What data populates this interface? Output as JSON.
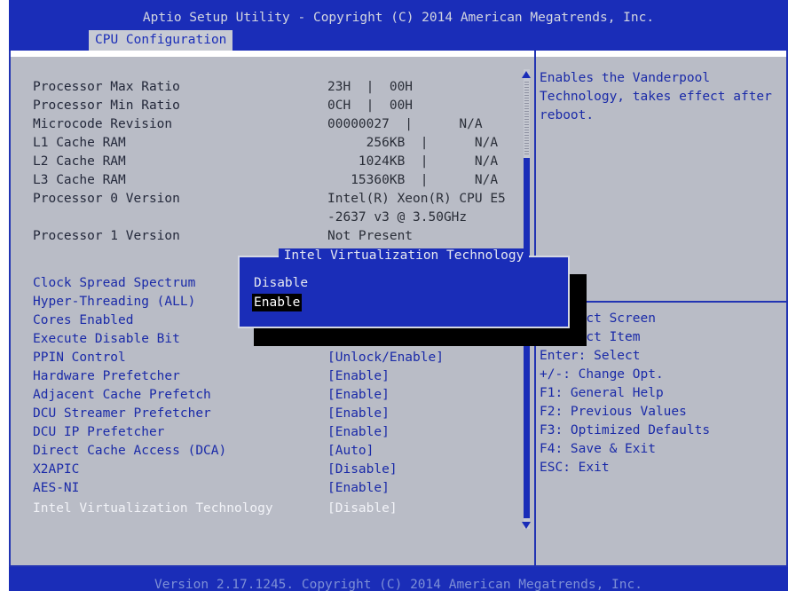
{
  "header": {
    "title": "Aptio Setup Utility - Copyright (C) 2014 American Megatrends, Inc.",
    "tab": "CPU Configuration"
  },
  "info_rows": [
    {
      "label": "Processor Max Ratio",
      "value": "23H  |  00H"
    },
    {
      "label": "Processor Min Ratio",
      "value": "0CH  |  00H"
    },
    {
      "label": "Microcode Revision",
      "value": "00000027  |      N/A"
    },
    {
      "label": "L1 Cache RAM",
      "value": "     256KB  |      N/A"
    },
    {
      "label": "L2 Cache RAM",
      "value": "    1024KB  |      N/A"
    },
    {
      "label": "L3 Cache RAM",
      "value": "   15360KB  |      N/A"
    },
    {
      "label": "Processor 0 Version",
      "value": "Intel(R) Xeon(R) CPU E5"
    },
    {
      "label": "",
      "value": "-2637 v3 @ 3.50GHz"
    },
    {
      "label": "Processor 1 Version",
      "value": "Not Present"
    }
  ],
  "settings": [
    {
      "label": "Clock Spread Spectrum",
      "value": ""
    },
    {
      "label": "Hyper-Threading (ALL)",
      "value": ""
    },
    {
      "label": "Cores Enabled",
      "value": ""
    },
    {
      "label": "Execute Disable Bit",
      "value": ""
    },
    {
      "label": "PPIN Control",
      "value": "[Unlock/Enable]"
    },
    {
      "label": "Hardware Prefetcher",
      "value": "[Enable]"
    },
    {
      "label": "Adjacent Cache Prefetch",
      "value": "[Enable]"
    },
    {
      "label": "DCU Streamer Prefetcher",
      "value": "[Enable]"
    },
    {
      "label": "DCU IP Prefetcher",
      "value": "[Enable]"
    },
    {
      "label": "Direct Cache Access (DCA)",
      "value": "[Auto]"
    },
    {
      "label": "X2APIC",
      "value": "[Disable]"
    },
    {
      "label": "AES-NI",
      "value": "[Enable]"
    },
    {
      "label": "Intel Virtualization Technology",
      "value": "[Disable]"
    }
  ],
  "help_text": "Enables the Vanderpool Technology, takes effect after reboot.",
  "keys": [
    "    lect Screen",
    "    lect Item",
    "Enter: Select",
    "+/-: Change Opt.",
    "F1: General Help",
    "F2: Previous Values",
    "F3: Optimized Defaults",
    "F4: Save & Exit",
    "ESC: Exit"
  ],
  "popup": {
    "title": "Intel Virtualization Technology",
    "options": [
      "Disable",
      "Enable"
    ],
    "selected": "Enable"
  },
  "footer": "Version 2.17.1245. Copyright (C) 2014 American Megatrends, Inc.",
  "colors": {
    "bios_blue": "#1a2db8",
    "panel_gray": "#b9bcc6",
    "highlight_text": "#f2f3f8"
  }
}
